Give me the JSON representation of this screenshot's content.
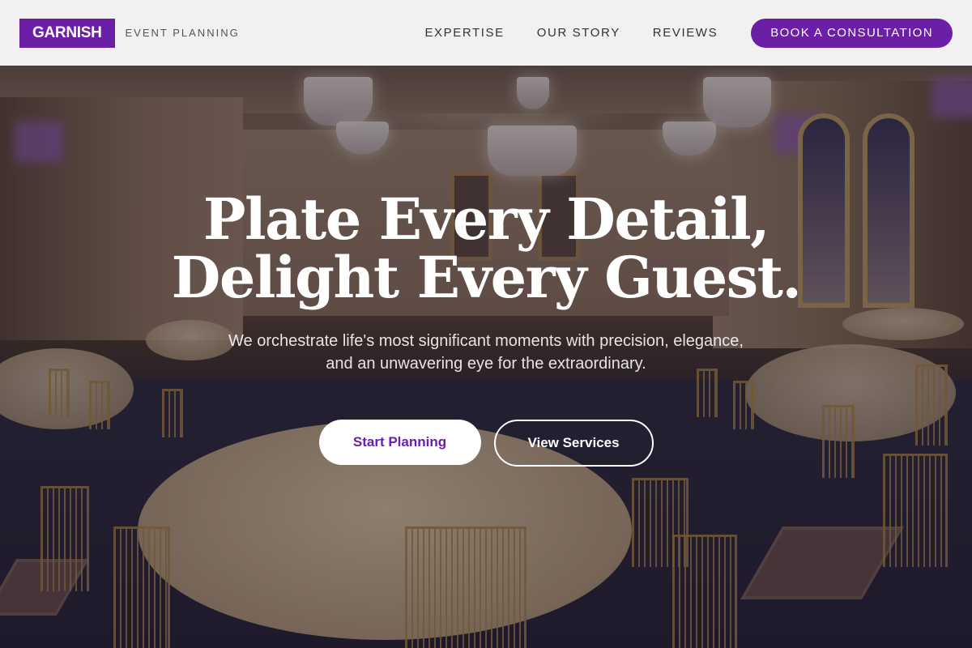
{
  "header": {
    "brand_name": "GARNISH",
    "brand_tagline": "EVENT PLANNING",
    "nav_items": [
      "EXPERTISE",
      "OUR STORY",
      "REVIEWS"
    ],
    "cta_label": "BOOK A CONSULTATION"
  },
  "hero": {
    "headline_line1": "Plate Every Detail,",
    "headline_line2": "Delight Every Guest.",
    "subtitle": "We orchestrate life's most significant moments with precision, elegance, and an unwavering eye for the extraordinary.",
    "primary_button": "Start Planning",
    "secondary_button": "View Services",
    "background_image": "ballroom-banquet-photo"
  },
  "colors": {
    "brand_purple": "#6a1fa6",
    "header_bg": "#f8f7f9",
    "white": "#ffffff"
  }
}
